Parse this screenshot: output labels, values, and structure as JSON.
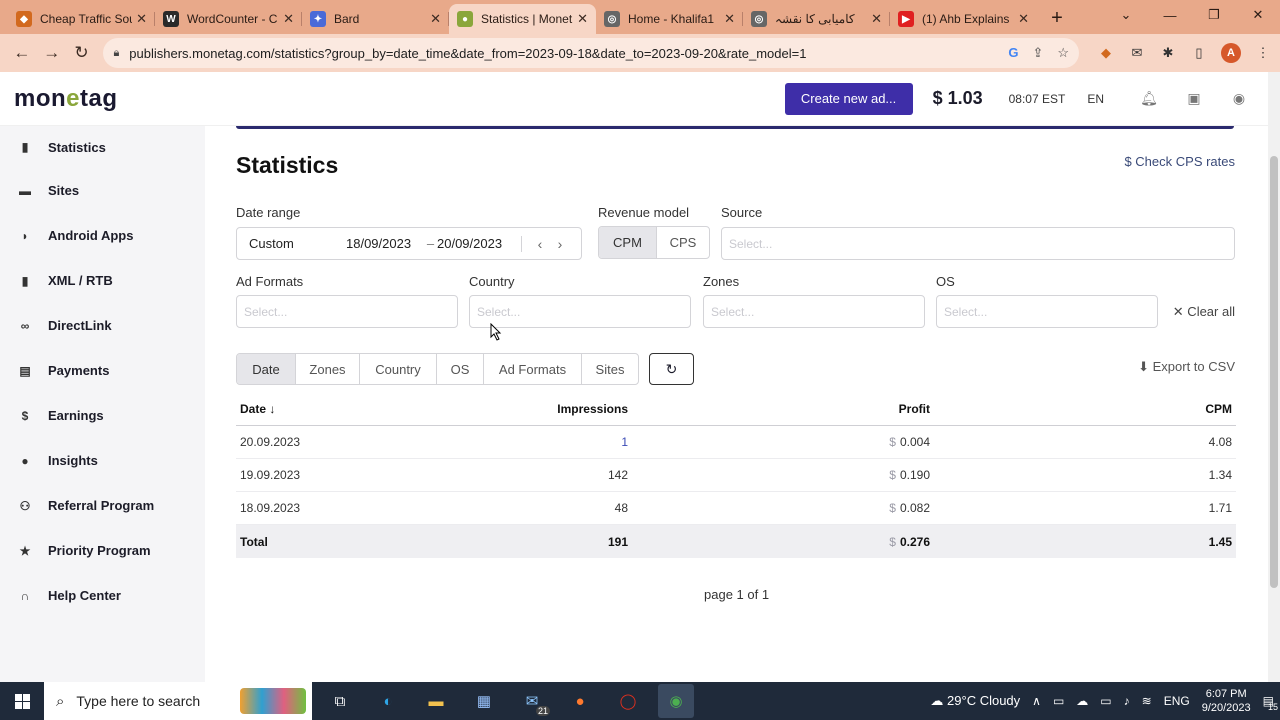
{
  "browser": {
    "tabs": [
      {
        "title": "Cheap Traffic Sou",
        "icon": "traffic-site-icon",
        "color": "#d2691e",
        "active": false
      },
      {
        "title": "WordCounter - C",
        "icon": "wordcounter-icon",
        "color": "#2a2a2a",
        "active": false
      },
      {
        "title": "Bard",
        "icon": "bard-icon",
        "color": "#4a6ad8",
        "active": false
      },
      {
        "title": "Statistics | Monet",
        "icon": "monetag-icon",
        "color": "#8aa63b",
        "active": true
      },
      {
        "title": "Home - Khalifa1",
        "icon": "globe-icon",
        "color": "#666666",
        "active": false
      },
      {
        "title": "کامیابی کا نقشہ",
        "icon": "globe-icon",
        "color": "#666666",
        "active": false
      },
      {
        "title": "(1) Ahb Explains",
        "icon": "youtube-icon",
        "color": "#e02020",
        "active": false
      }
    ],
    "url": "publishers.monetag.com/statistics?group_by=date_time&date_from=2023-09-18&date_to=2023-09-20&rate_model=1",
    "profile_initial": "A"
  },
  "header": {
    "logo_prefix": "mon",
    "logo_e": "e",
    "logo_suffix": "tag",
    "create_button": "Create new ad...",
    "balance": "$ 1.03",
    "time": "08:07 EST",
    "language": "EN"
  },
  "sidebar": {
    "items": [
      {
        "label": "Statistics",
        "icon": "bar-chart-icon"
      },
      {
        "label": "Sites",
        "icon": "sites-icon"
      },
      {
        "label": "Android Apps",
        "icon": "android-icon"
      },
      {
        "label": "XML / RTB",
        "icon": "file-icon"
      },
      {
        "label": "DirectLink",
        "icon": "link-icon"
      },
      {
        "label": "Payments",
        "icon": "payments-icon"
      },
      {
        "label": "Earnings",
        "icon": "dollar-icon"
      },
      {
        "label": "Insights",
        "icon": "lightbulb-icon"
      },
      {
        "label": "Referral Program",
        "icon": "users-icon"
      },
      {
        "label": "Priority Program",
        "icon": "star-icon"
      },
      {
        "label": "Help Center",
        "icon": "headset-icon"
      }
    ]
  },
  "main": {
    "title": "Statistics",
    "cps_link": "$ Check CPS rates",
    "date_range": {
      "label": "Date range",
      "mode": "Custom",
      "from": "18/09/2023",
      "separator": "–",
      "to": "20/09/2023"
    },
    "revenue_model": {
      "label": "Revenue model",
      "options": [
        "CPM",
        "CPS"
      ],
      "selected": "CPM"
    },
    "source": {
      "label": "Source",
      "placeholder": "Select..."
    },
    "ad_formats": {
      "label": "Ad Formats",
      "placeholder": "Select..."
    },
    "country": {
      "label": "Country",
      "placeholder": "Select..."
    },
    "zones": {
      "label": "Zones",
      "placeholder": "Select..."
    },
    "os": {
      "label": "OS",
      "placeholder": "Select..."
    },
    "clear_all": "✕ Clear all",
    "group_by": [
      "Date",
      "Zones",
      "Country",
      "OS",
      "Ad Formats",
      "Sites"
    ],
    "group_selected": "Date",
    "export": "Export to CSV",
    "table": {
      "headers": {
        "date": "Date",
        "impressions": "Impressions",
        "profit": "Profit",
        "cpm": "CPM"
      },
      "rows": [
        {
          "date": "20.09.2023",
          "impressions": "1",
          "profit": "0.004",
          "cpm": "4.08"
        },
        {
          "date": "19.09.2023",
          "impressions": "142",
          "profit": "0.190",
          "cpm": "1.34"
        },
        {
          "date": "18.09.2023",
          "impressions": "48",
          "profit": "0.082",
          "cpm": "1.71"
        }
      ],
      "total": {
        "label": "Total",
        "impressions": "191",
        "profit": "0.276",
        "cpm": "1.45"
      },
      "currency": "$"
    },
    "pager": "page 1 of 1"
  },
  "taskbar": {
    "search_placeholder": "Type here to search",
    "weather": "29°C  Cloudy",
    "language": "ENG",
    "time": "6:07 PM",
    "date": "9/20/2023",
    "mail_badge": "21",
    "notification_count": "15"
  }
}
